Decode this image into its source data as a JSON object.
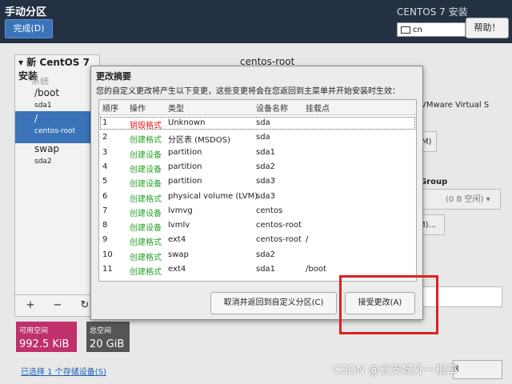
{
  "header": {
    "title": "手动分区",
    "done_label": "完成(D)",
    "product": "CENTOS 7 安装",
    "keyboard": "cn",
    "help_label": "帮助！"
  },
  "left": {
    "install_title": "新 CentOS 7 安装",
    "system_label": "系统",
    "mounts": [
      {
        "name": "/boot",
        "device": "sda1"
      },
      {
        "name": "/",
        "device": "centos-root"
      },
      {
        "name": "swap",
        "device": "sda2"
      }
    ],
    "btn_add": "+",
    "btn_remove": "−",
    "btn_refresh": "↻"
  },
  "space": {
    "available_label": "可用空间",
    "available_value": "992.5 KiB",
    "total_label": "总空间",
    "total_value": "20 GiB",
    "storage_link": "已选择 1 个存储设备(S)"
  },
  "right": {
    "section_title": "centos-root",
    "device_text": "VMware Virtual S",
    "group_label": "Group",
    "free_text": "(0 B 空闲)",
    "modify_hint": "(M)",
    "modify_hint2": "M)...",
    "reset_label": "R"
  },
  "dialog": {
    "title": "更改摘要",
    "subtitle": "您的自定义更改将产生以下变更，这些变更将会在您返回到主菜单并开始安装时生效：",
    "columns": [
      "顺序",
      "操作",
      "类型",
      "设备名称",
      "挂载点"
    ],
    "rows": [
      {
        "order": "1",
        "action": "销毁格式",
        "type": "Unknown",
        "device": "sda",
        "mount": ""
      },
      {
        "order": "2",
        "action": "创建格式",
        "type": "分区表 (MSDOS)",
        "device": "sda",
        "mount": ""
      },
      {
        "order": "3",
        "action": "创建设备",
        "type": "partition",
        "device": "sda1",
        "mount": ""
      },
      {
        "order": "4",
        "action": "创建设备",
        "type": "partition",
        "device": "sda2",
        "mount": ""
      },
      {
        "order": "5",
        "action": "创建设备",
        "type": "partition",
        "device": "sda3",
        "mount": ""
      },
      {
        "order": "6",
        "action": "创建格式",
        "type": "physical volume (LVM)",
        "device": "sda3",
        "mount": ""
      },
      {
        "order": "7",
        "action": "创建设备",
        "type": "lvmvg",
        "device": "centos",
        "mount": ""
      },
      {
        "order": "8",
        "action": "创建设备",
        "type": "lvmlv",
        "device": "centos-root",
        "mount": ""
      },
      {
        "order": "9",
        "action": "创建格式",
        "type": "ext4",
        "device": "centos-root",
        "mount": "/"
      },
      {
        "order": "10",
        "action": "创建格式",
        "type": "swap",
        "device": "sda2",
        "mount": ""
      },
      {
        "order": "11",
        "action": "创建格式",
        "type": "ext4",
        "device": "sda1",
        "mount": "/boot"
      }
    ],
    "cancel_label": "取消并返回到自定义分区(C)",
    "accept_label": "接受更改(A)"
  },
  "colors": {
    "destroy": "#e02020",
    "create": "#2aa02a",
    "accent": "#3a73b8",
    "highlight": "#e02020"
  },
  "watermark": "CSDN @长安城外一根草"
}
